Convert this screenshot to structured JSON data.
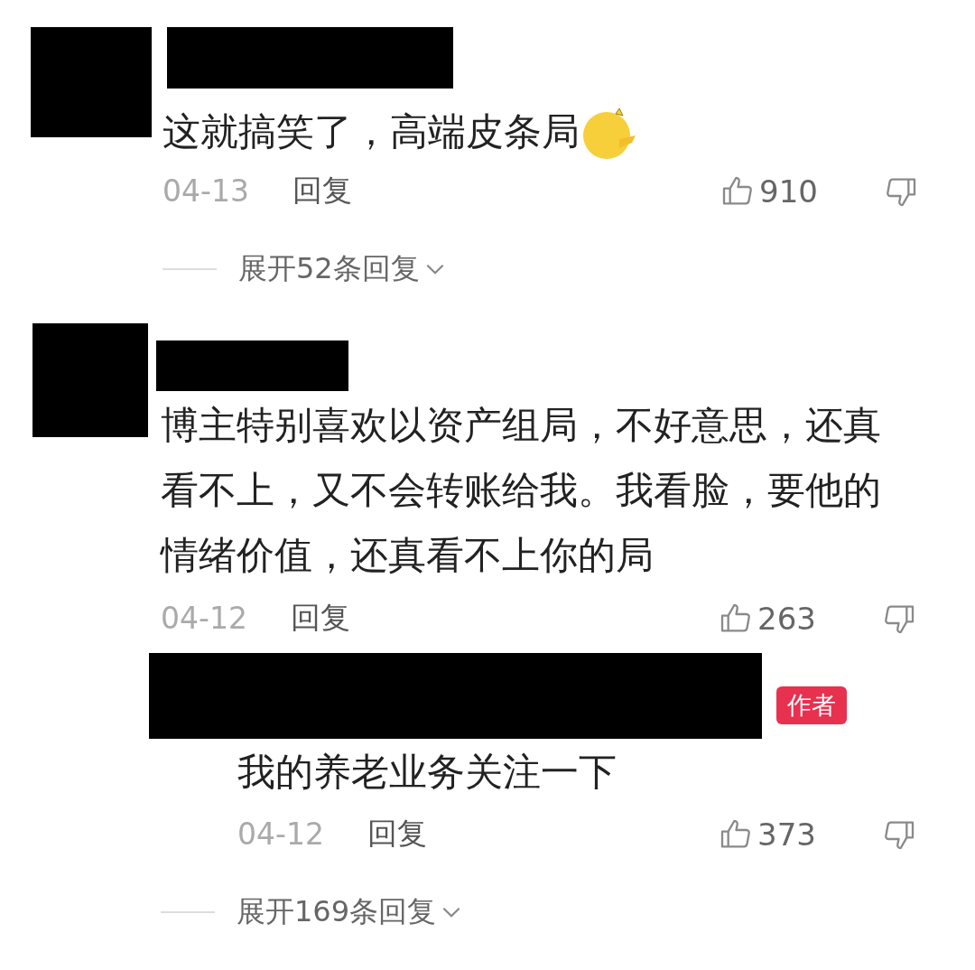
{
  "comments": [
    {
      "text": "这就搞笑了，高端皮条局",
      "emoji": true,
      "date": "04-13",
      "reply_label": "回复",
      "likes": "910",
      "expand": "展开52条回复"
    },
    {
      "text": "博主特别喜欢以资产组局，不好意思，还真看不上，又不会转账给我。我看脸，要他的情绪价值，还真看不上你的局",
      "emoji": false,
      "date": "04-12",
      "reply_label": "回复",
      "likes": "263",
      "replies": [
        {
          "author_badge": "作者",
          "text": "我的养老业务关注一下",
          "date": "04-12",
          "reply_label": "回复",
          "likes": "373"
        }
      ],
      "expand": "展开169条回复"
    }
  ]
}
